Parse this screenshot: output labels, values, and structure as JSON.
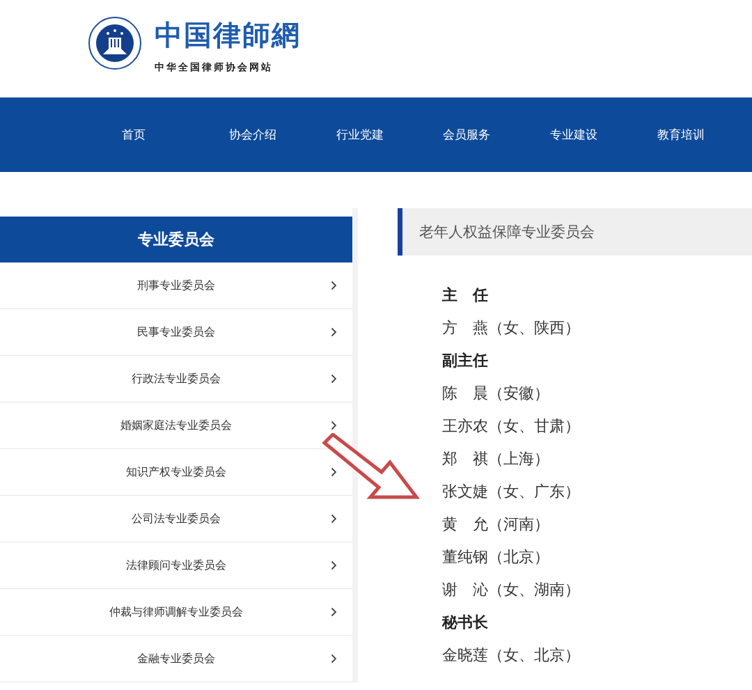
{
  "logo": {
    "title": "中国律師網",
    "subtitle": "中华全国律师协会网站"
  },
  "nav": [
    {
      "label": "首页"
    },
    {
      "label": "协会介绍"
    },
    {
      "label": "行业党建"
    },
    {
      "label": "会员服务"
    },
    {
      "label": "专业建设"
    },
    {
      "label": "教育培训"
    }
  ],
  "sidebar": {
    "title": "专业委员会",
    "items": [
      {
        "label": "刑事专业委员会"
      },
      {
        "label": "民事专业委员会"
      },
      {
        "label": "行政法专业委员会"
      },
      {
        "label": "婚姻家庭法专业委员会"
      },
      {
        "label": "知识产权专业委员会"
      },
      {
        "label": "公司法专业委员会"
      },
      {
        "label": "法律顾问专业委员会"
      },
      {
        "label": "仲裁与律师调解专业委员会"
      },
      {
        "label": "金融专业委员会"
      }
    ]
  },
  "content": {
    "title": "老年人权益保障专业委员会",
    "lines": [
      {
        "kind": "heading",
        "text": "主　任"
      },
      {
        "kind": "member",
        "text": "方　燕（女、陕西）"
      },
      {
        "kind": "heading",
        "text": "副主任"
      },
      {
        "kind": "member",
        "text": "陈　晨（安徽）"
      },
      {
        "kind": "member",
        "text": "王亦农（女、甘肃）"
      },
      {
        "kind": "member",
        "text": "郑　祺（上海）"
      },
      {
        "kind": "member",
        "text": "张文婕（女、广东）"
      },
      {
        "kind": "member",
        "text": "黄　允（河南）"
      },
      {
        "kind": "member",
        "text": "董纯钢（北京）"
      },
      {
        "kind": "member",
        "text": "谢　沁（女、湖南）"
      },
      {
        "kind": "heading",
        "text": "秘书长"
      },
      {
        "kind": "member",
        "text": "金晓莲（女、北京）"
      }
    ]
  }
}
